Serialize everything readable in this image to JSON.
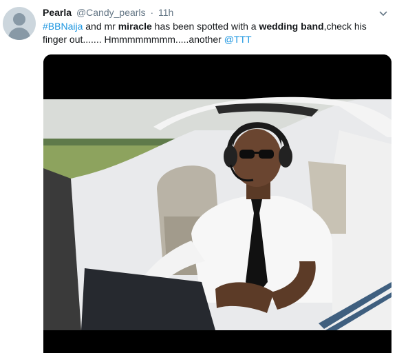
{
  "tweet": {
    "author_name": "Pearla",
    "author_handle": "@Candy_pearls",
    "separator": "·",
    "time": "11h",
    "text": {
      "hashtag": "#BBNaija",
      "part1": " and mr ",
      "bold1": "miracle",
      "part2": " has been spotted with a ",
      "bold2": "wedding band",
      "part3": ",check his finger out....... Hmmmmmmmm.....another ",
      "mention": "@TTT"
    },
    "icons": {
      "avatar": "default-avatar-icon",
      "menu": "chevron-down-icon"
    },
    "colors": {
      "link": "#1b95e0",
      "secondary_text": "#657786",
      "primary_text": "#14171a"
    }
  }
}
